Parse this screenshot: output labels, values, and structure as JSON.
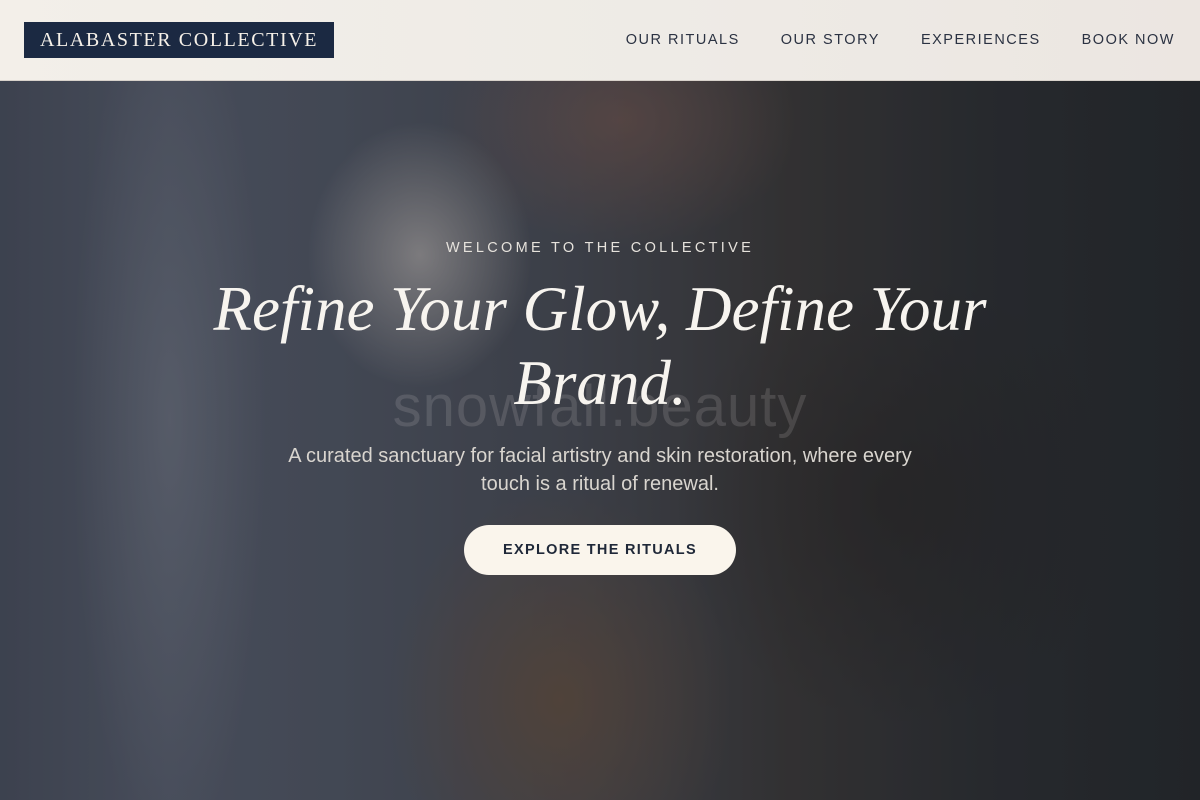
{
  "header": {
    "logo_text": "ALABASTER COLLECTIVE",
    "nav": [
      {
        "label": "OUR RITUALS"
      },
      {
        "label": "OUR STORY"
      },
      {
        "label": "EXPERIENCES"
      },
      {
        "label": "BOOK NOW"
      }
    ]
  },
  "hero": {
    "eyebrow": "WELCOME TO THE COLLECTIVE",
    "headline": "Refine Your Glow, Define Your Brand.",
    "watermark": "snowfall.beauty",
    "subtext": "A curated sanctuary for facial artistry and skin restoration, where every touch is a ritual of renewal.",
    "cta_label": "EXPLORE THE RITUALS"
  },
  "colors": {
    "logo_background": "#1b2942",
    "header_background": "#f0ece6",
    "cta_background": "#faf5ec",
    "cta_text": "#1f2838"
  }
}
